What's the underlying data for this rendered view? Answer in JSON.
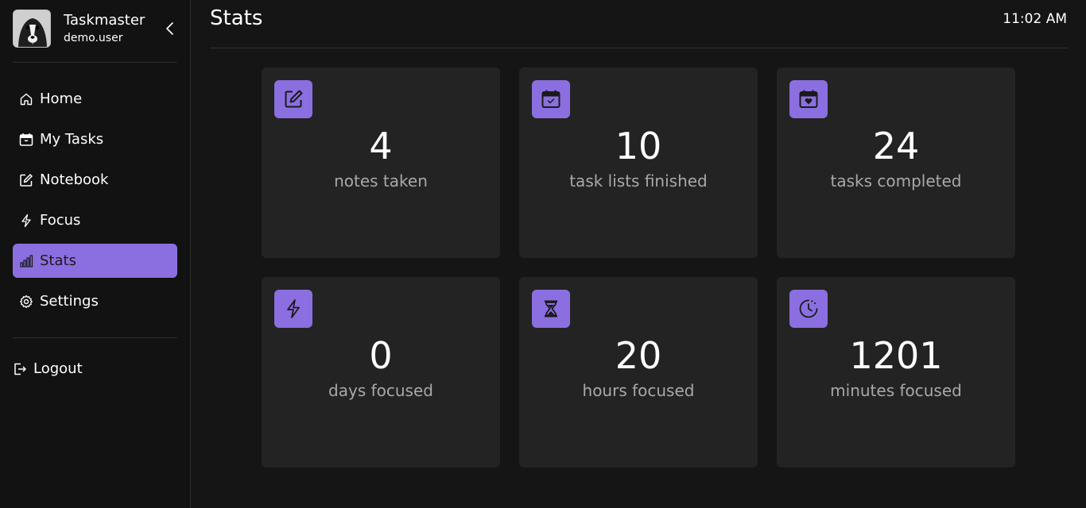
{
  "sidebar": {
    "app_name": "Taskmaster",
    "username": "demo.user",
    "nav": [
      {
        "label": "Home",
        "icon": "home-icon"
      },
      {
        "label": "My Tasks",
        "icon": "calendar-icon"
      },
      {
        "label": "Notebook",
        "icon": "edit-icon"
      },
      {
        "label": "Focus",
        "icon": "lightning-icon"
      },
      {
        "label": "Stats",
        "icon": "bar-chart-icon",
        "active": true
      },
      {
        "label": "Settings",
        "icon": "gear-icon"
      }
    ],
    "logout_label": "Logout"
  },
  "header": {
    "title": "Stats",
    "time": "11:02 AM"
  },
  "stats": [
    {
      "value": "4",
      "label": "notes taken",
      "icon": "edit-icon"
    },
    {
      "value": "10",
      "label": "task lists finished",
      "icon": "calendar-check-icon"
    },
    {
      "value": "24",
      "label": "tasks completed",
      "icon": "calendar-heart-icon"
    },
    {
      "value": "0",
      "label": "days focused",
      "icon": "lightning-icon"
    },
    {
      "value": "20",
      "label": "hours focused",
      "icon": "hourglass-icon"
    },
    {
      "value": "1201",
      "label": "minutes focused",
      "icon": "clock-icon"
    }
  ],
  "colors": {
    "accent": "#8b6fe0",
    "background": "#151515",
    "card": "#232323",
    "muted_text": "#a8a8a8"
  }
}
